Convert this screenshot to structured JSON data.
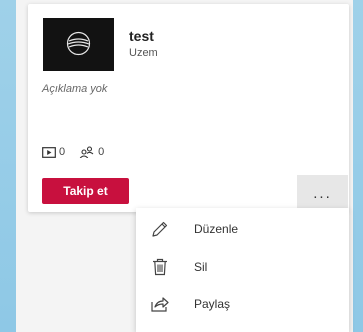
{
  "card": {
    "title": "test",
    "author": "Uzem",
    "description": "Açıklama yok",
    "video_count": "0",
    "follower_count": "0",
    "follow_label": "Takip et",
    "more_label": "..."
  },
  "menu": {
    "items": [
      {
        "label": "Düzenle",
        "icon": "pencil-icon"
      },
      {
        "label": "Sil",
        "icon": "trash-icon"
      },
      {
        "label": "Paylaş",
        "icon": "share-icon"
      }
    ]
  },
  "colors": {
    "follow_button": "#c8103e",
    "thumbnail": "#121212",
    "frame": "#8ec8e6"
  }
}
